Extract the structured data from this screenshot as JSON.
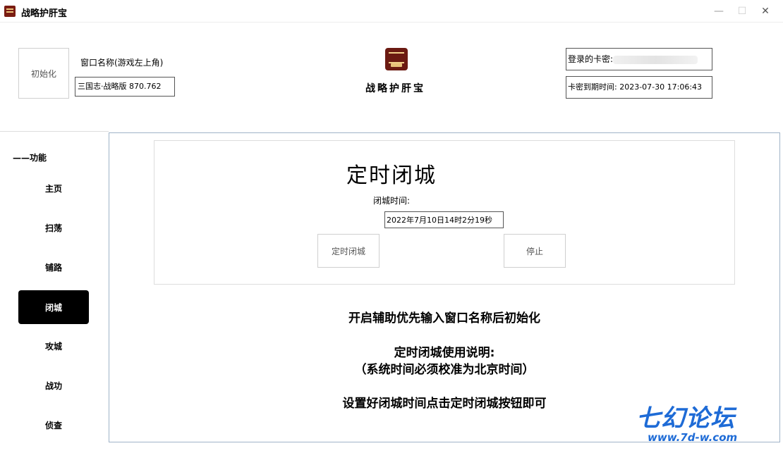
{
  "window": {
    "title": "战略护肝宝",
    "minimize": "—",
    "maximize": "☐",
    "close": "✕"
  },
  "header": {
    "init_label": "初始化",
    "window_name_label": "窗口名称(游戏左上角)",
    "window_name_value": "三国志·战略版 870.762",
    "brand_name": "战略护肝宝",
    "card_key_label": "登录的卡密:",
    "expiry_text": "卡密到期时间: 2023-07-30 17:06:43"
  },
  "sidebar": {
    "section_title": "——功能",
    "items": [
      {
        "label": "主页",
        "active": false
      },
      {
        "label": "扫荡",
        "active": false
      },
      {
        "label": "铺路",
        "active": false
      },
      {
        "label": "闭城",
        "active": true
      },
      {
        "label": "攻城",
        "active": false
      },
      {
        "label": "战功",
        "active": false
      },
      {
        "label": "侦查",
        "active": false
      }
    ]
  },
  "main": {
    "title": "定时闭城",
    "time_label": "闭城时间:",
    "time_value": "2022年7月10日14时2分19秒",
    "timed_button": "定时闭城",
    "stop_button": "停止",
    "notes": [
      "开启辅助优先输入窗口名称后初始化",
      "定时闭城使用说明:",
      "（系统时间必须校准为北京时间）",
      "设置好闭城时间点击定时闭城按钮即可"
    ]
  },
  "watermark": {
    "main": "七幻论坛",
    "url": "www.7d-w.com"
  }
}
